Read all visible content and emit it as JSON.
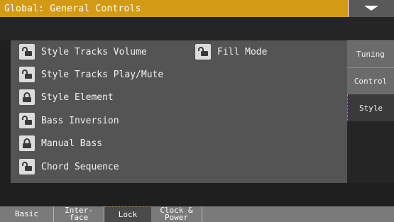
{
  "header": {
    "title": "Global: General Controls",
    "menu_icon": "triangle-down-icon",
    "accent_color": "#d39a16"
  },
  "lock_items": [
    {
      "label": "Style Tracks Volume",
      "icon": "unlocked-padlock-icon",
      "locked": false
    },
    {
      "label": "Fill Mode",
      "icon": "unlocked-padlock-icon",
      "locked": false
    },
    {
      "label": "Style Tracks Play/Mute",
      "icon": "unlocked-padlock-icon",
      "locked": false
    },
    {
      "label": "Style Element",
      "icon": "locked-padlock-icon",
      "locked": true
    },
    {
      "label": "Bass Inversion",
      "icon": "unlocked-padlock-icon",
      "locked": false
    },
    {
      "label": "Manual Bass",
      "icon": "locked-padlock-icon",
      "locked": true
    },
    {
      "label": "Chord Sequence",
      "icon": "unlocked-padlock-icon",
      "locked": false
    }
  ],
  "side_tabs": [
    {
      "label": "Tuning",
      "active": false
    },
    {
      "label": "Control",
      "active": false
    },
    {
      "label": "Style",
      "active": true
    }
  ],
  "bottom_tabs": [
    {
      "line1": "Basic",
      "line2": "",
      "active": false
    },
    {
      "line1": "Inter-",
      "line2": "face",
      "active": false
    },
    {
      "line1": "Lock",
      "line2": "",
      "active": true
    },
    {
      "line1": "Clock &",
      "line2": "Power",
      "active": false
    }
  ]
}
